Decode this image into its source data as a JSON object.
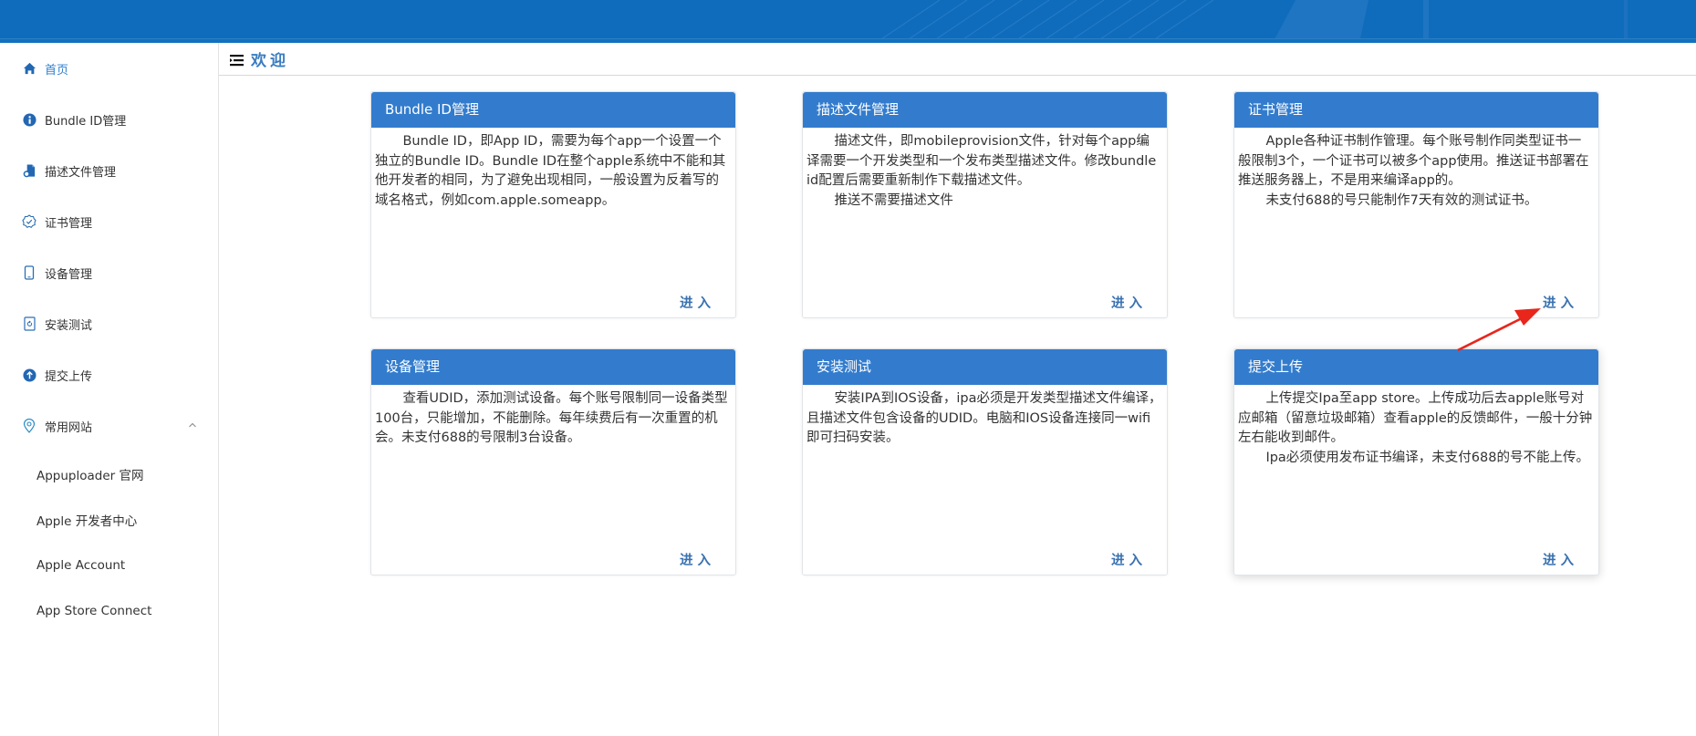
{
  "header": {
    "brand_color": "#0f6cbd"
  },
  "sidebar": {
    "items": [
      {
        "label": "首页",
        "icon": "home-icon",
        "active": true
      },
      {
        "label": "Bundle ID管理",
        "icon": "info-icon",
        "active": false
      },
      {
        "label": "描述文件管理",
        "icon": "file-gear-icon",
        "active": false
      },
      {
        "label": "证书管理",
        "icon": "badge-check-icon",
        "active": false
      },
      {
        "label": "设备管理",
        "icon": "phone-icon",
        "active": false
      },
      {
        "label": "安装测试",
        "icon": "install-icon",
        "active": false
      },
      {
        "label": "提交上传",
        "icon": "upload-icon",
        "active": false
      }
    ],
    "group": {
      "label": "常用网站",
      "icon": "location-pin-icon",
      "expanded": true,
      "items": [
        {
          "label": "Appuploader 官网"
        },
        {
          "label": "Apple 开发者中心"
        },
        {
          "label": "Apple Account"
        },
        {
          "label": "App Store Connect"
        }
      ]
    }
  },
  "page": {
    "title": "欢迎",
    "menu_icon": "menu-icon"
  },
  "cards": [
    {
      "title": "Bundle ID管理",
      "paragraphs": [
        "Bundle ID，即App ID，需要为每个app一个设置一个独立的Bundle ID。Bundle ID在整个apple系统中不能和其他开发者的相同，为了避免出现相同，一般设置为反着写的域名格式，例如com.apple.someapp。"
      ],
      "enter_label": "进入"
    },
    {
      "title": "描述文件管理",
      "paragraphs": [
        "描述文件，即mobileprovision文件，针对每个app编译需要一个开发类型和一个发布类型描述文件。修改bundle id配置后需要重新制作下载描述文件。",
        "推送不需要描述文件"
      ],
      "enter_label": "进入"
    },
    {
      "title": "证书管理",
      "paragraphs": [
        "Apple各种证书制作管理。每个账号制作同类型证书一般限制3个，一个证书可以被多个app使用。推送证书部署在推送服务器上，不是用来编译app的。",
        "未支付688的号只能制作7天有效的测试证书。"
      ],
      "enter_label": "进入"
    },
    {
      "title": "设备管理",
      "paragraphs": [
        "查看UDID，添加测试设备。每个账号限制同一设备类型100台，只能增加，不能删除。每年续费后有一次重置的机会。未支付688的号限制3台设备。"
      ],
      "enter_label": "进入"
    },
    {
      "title": "安装测试",
      "paragraphs": [
        "安装IPA到IOS设备，ipa必须是开发类型描述文件编译，且描述文件包含设备的UDID。电脑和IOS设备连接同一wifi即可扫码安装。"
      ],
      "enter_label": "进入"
    },
    {
      "title": "提交上传",
      "paragraphs": [
        "上传提交Ipa至app store。上传成功后去apple账号对应邮箱（留意垃圾邮箱）查看apple的反馈邮件，一般十分钟左右能收到邮件。",
        "Ipa必须使用发布证书编译，未支付688的号不能上传。"
      ],
      "enter_label": "进入"
    }
  ],
  "annotation": {
    "type": "red-arrow",
    "target": "证书管理 进入",
    "color": "#e8261c"
  }
}
